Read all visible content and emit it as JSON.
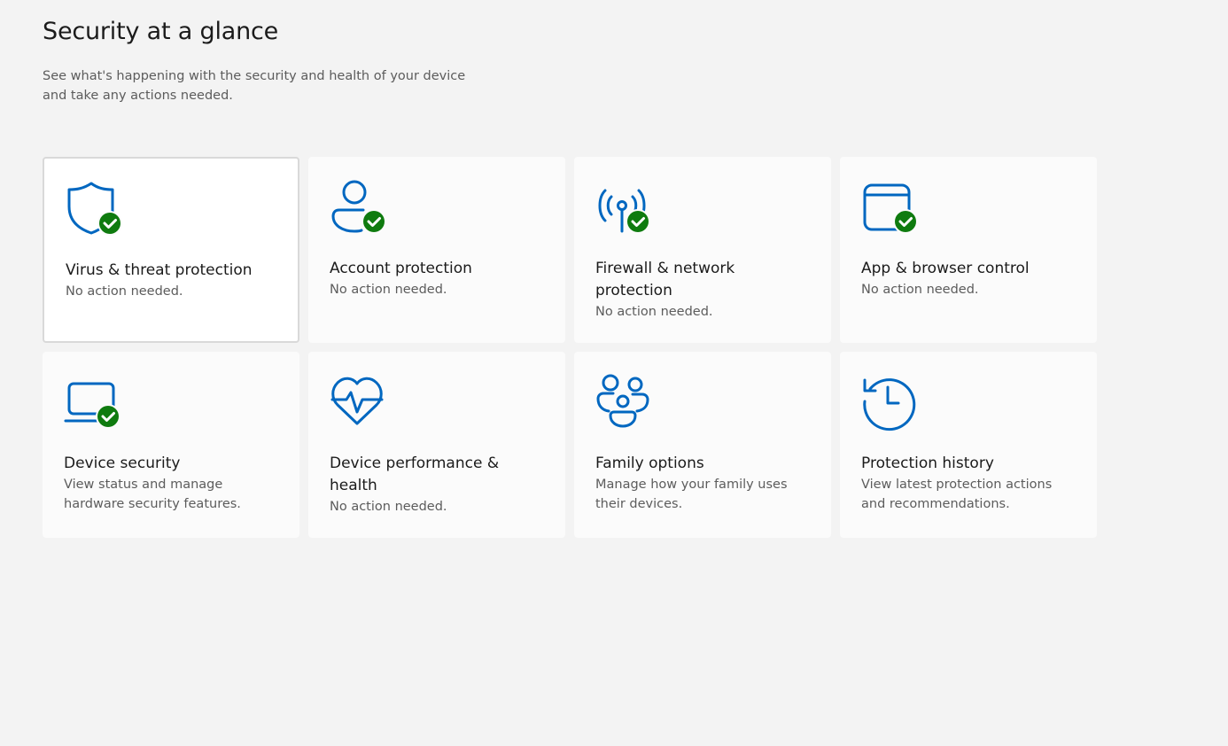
{
  "header": {
    "title": "Security at a glance",
    "subtitle": "See what's happening with the security and health of your device and take any actions needed."
  },
  "colors": {
    "accent": "#0067c0",
    "ok_badge": "#0f7b0f",
    "background": "#f3f3f3",
    "tile": "#fbfbfb"
  },
  "tiles": [
    {
      "title": "Virus & threat protection",
      "status": "No action needed.",
      "icon": "shield-icon",
      "badge": "check-badge-icon"
    },
    {
      "title": "Account protection",
      "status": "No action needed.",
      "icon": "person-icon",
      "badge": "check-badge-icon"
    },
    {
      "title": "Firewall & network protection",
      "status": "No action needed.",
      "icon": "antenna-icon",
      "badge": "check-badge-icon"
    },
    {
      "title": "App & browser control",
      "status": "No action needed.",
      "icon": "browser-window-icon",
      "badge": "check-badge-icon"
    },
    {
      "title": "Device security",
      "status": "View status and manage hardware security features.",
      "icon": "laptop-icon",
      "badge": "check-badge-icon"
    },
    {
      "title": "Device performance & health",
      "status": "No action needed.",
      "icon": "heart-pulse-icon"
    },
    {
      "title": "Family options",
      "status": "Manage how your family uses their devices.",
      "icon": "family-icon"
    },
    {
      "title": "Protection history",
      "status": "View latest protection actions and recommendations.",
      "icon": "history-clock-icon"
    }
  ]
}
